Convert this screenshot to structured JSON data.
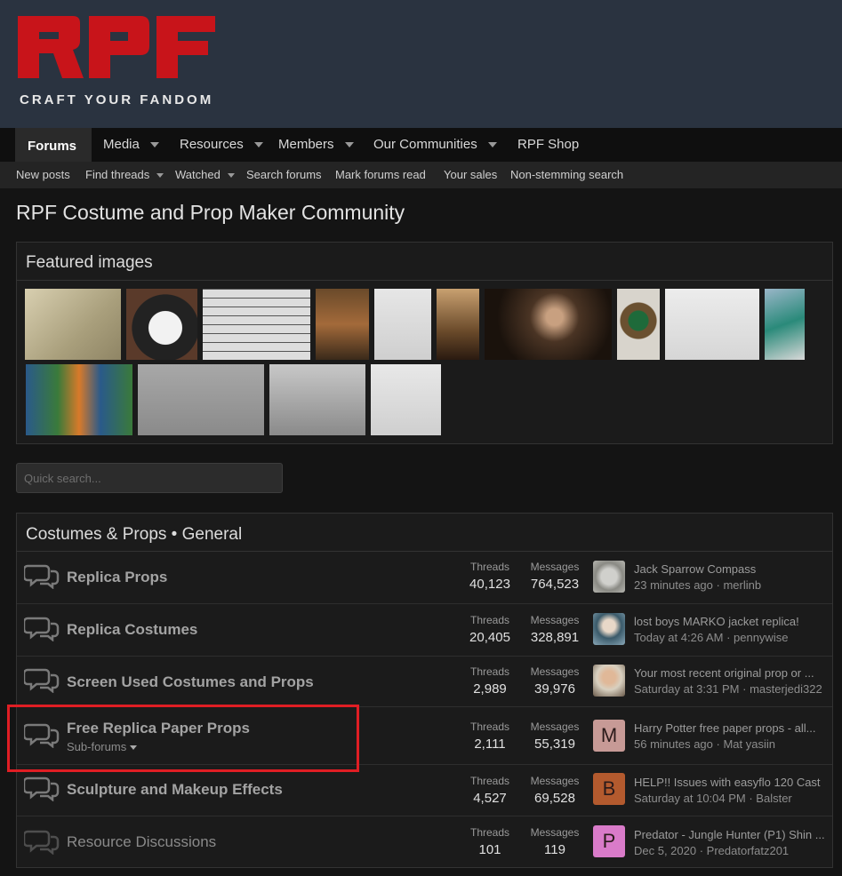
{
  "brand": {
    "logo_text": "RPF",
    "tagline": "CRAFT YOUR FANDOM",
    "logo_color": "#c8141a"
  },
  "nav": {
    "items": [
      {
        "label": "Forums",
        "active": true
      },
      {
        "label": "Media",
        "dropdown": true
      },
      {
        "label": "Resources",
        "dropdown": true
      },
      {
        "label": "Members",
        "dropdown": true
      },
      {
        "label": "Our Communities",
        "dropdown": true
      },
      {
        "label": "RPF Shop"
      }
    ]
  },
  "subnav": {
    "items": [
      {
        "label": "New posts"
      },
      {
        "label": "Find threads",
        "dropdown": true
      },
      {
        "label": "Watched",
        "dropdown": true
      },
      {
        "label": "Search forums"
      },
      {
        "label": "Mark forums read"
      },
      {
        "label": "Your sales"
      },
      {
        "label": "Non-stemming search"
      }
    ]
  },
  "page_title": "RPF Costume and Prop Maker Community",
  "featured": {
    "title": "Featured images",
    "image_count": 14
  },
  "search": {
    "placeholder": "Quick search...",
    "value": ""
  },
  "category": {
    "title": "Costumes & Props • General",
    "stat_labels": {
      "threads": "Threads",
      "messages": "Messages"
    },
    "forums": [
      {
        "title": "Replica Props",
        "threads": "40,123",
        "messages": "764,523",
        "last_title": "Jack Sparrow Compass",
        "last_meta": "23 minutes ago · merlinb",
        "avatar_letter": "",
        "avatar_color": "#9a9a96"
      },
      {
        "title": "Replica Costumes",
        "threads": "20,405",
        "messages": "328,891",
        "last_title": "lost boys MARKO jacket replica!",
        "last_meta": "Today at 4:26 AM · pennywise",
        "avatar_letter": "",
        "avatar_color": "#7e8a95"
      },
      {
        "title": "Screen Used Costumes and Props",
        "threads": "2,989",
        "messages": "39,976",
        "last_title": "Your most recent original prop or ...",
        "last_meta": "Saturday at 3:31 PM · masterjedi322",
        "avatar_letter": "",
        "avatar_color": "#b38a6a"
      },
      {
        "title": "Free Replica Paper Props",
        "subforums": "Sub-forums",
        "threads": "2,111",
        "messages": "55,319",
        "last_title": "Harry Potter free paper props - all...",
        "last_meta": "56 minutes ago · Mat yasiin",
        "avatar_letter": "M",
        "avatar_color": "#c79a96"
      },
      {
        "title": "Sculpture and Makeup Effects",
        "threads": "4,527",
        "messages": "69,528",
        "last_title": "HELP!! Issues with easyflo 120 Cast",
        "last_meta": "Saturday at 10:04 PM · Balster",
        "avatar_letter": "B",
        "avatar_color": "#b35a2e"
      },
      {
        "title": "Resource Discussions",
        "threads": "101",
        "messages": "119",
        "last_title": "Predator - Jungle Hunter (P1) Shin ...",
        "last_meta": "Dec 5, 2020 · Predatorfatz201",
        "avatar_letter": "P",
        "avatar_color": "#d97bc9"
      }
    ]
  }
}
